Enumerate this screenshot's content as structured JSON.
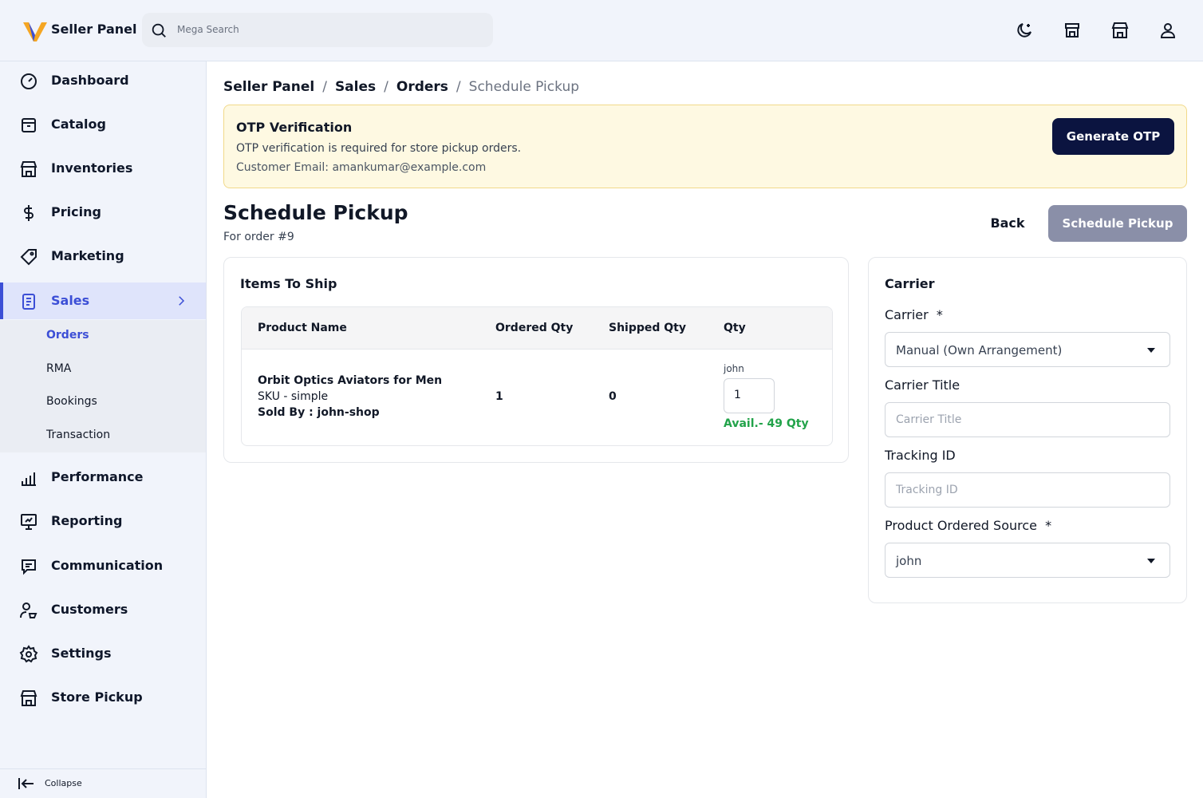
{
  "header": {
    "brand": "Seller Panel",
    "search_placeholder": "Mega Search",
    "icons": [
      "dark-mode-icon",
      "store-icon",
      "storefront-icon",
      "user-icon"
    ]
  },
  "sidebar": {
    "items": [
      {
        "label": "Dashboard",
        "icon": "dashboard-icon"
      },
      {
        "label": "Catalog",
        "icon": "catalog-icon"
      },
      {
        "label": "Inventories",
        "icon": "inventories-icon"
      },
      {
        "label": "Pricing",
        "icon": "dollar-icon"
      },
      {
        "label": "Marketing",
        "icon": "tag-icon"
      },
      {
        "label": "Sales",
        "icon": "receipt-icon",
        "active": true
      },
      {
        "label": "Performance",
        "icon": "bar-chart-icon"
      },
      {
        "label": "Reporting",
        "icon": "presentation-icon"
      },
      {
        "label": "Communication",
        "icon": "chat-icon"
      },
      {
        "label": "Customers",
        "icon": "customers-icon"
      },
      {
        "label": "Settings",
        "icon": "gear-icon"
      },
      {
        "label": "Store Pickup",
        "icon": "store-pickup-icon"
      }
    ],
    "sales_sub": [
      "Orders",
      "RMA",
      "Bookings",
      "Transaction"
    ],
    "collapse_label": "Collapse",
    "accent": "#3c4fd6"
  },
  "breadcrumb": [
    "Seller Panel",
    "Sales",
    "Orders",
    "Schedule Pickup"
  ],
  "otp": {
    "title": "OTP Verification",
    "desc": "OTP verification is required for store pickup orders.",
    "email": "Customer Email: amankumar@example.com",
    "button": "Generate OTP"
  },
  "page": {
    "title": "Schedule Pickup",
    "subtitle": "For order #9",
    "back": "Back",
    "submit": "Schedule Pickup"
  },
  "items": {
    "title": "Items To Ship",
    "columns": [
      "Product Name",
      "Ordered Qty",
      "Shipped Qty",
      "Qty"
    ],
    "row": {
      "name": "Orbit Optics Aviators for Men",
      "sku": "SKU - simple",
      "sold_by": "Sold By : john-shop",
      "ordered": "1",
      "shipped": "0",
      "source_label": "john",
      "qty": "1",
      "avail": "Avail.- 49 Qty"
    }
  },
  "carrier": {
    "title": "Carrier",
    "carrier_label": "Carrier",
    "required_mark": "*",
    "carrier_value": "Manual (Own Arrangement)",
    "title_label": "Carrier Title",
    "title_placeholder": "Carrier Title",
    "tracking_label": "Tracking ID",
    "tracking_placeholder": "Tracking ID",
    "source_label": "Product Ordered Source",
    "source_value": "john"
  }
}
